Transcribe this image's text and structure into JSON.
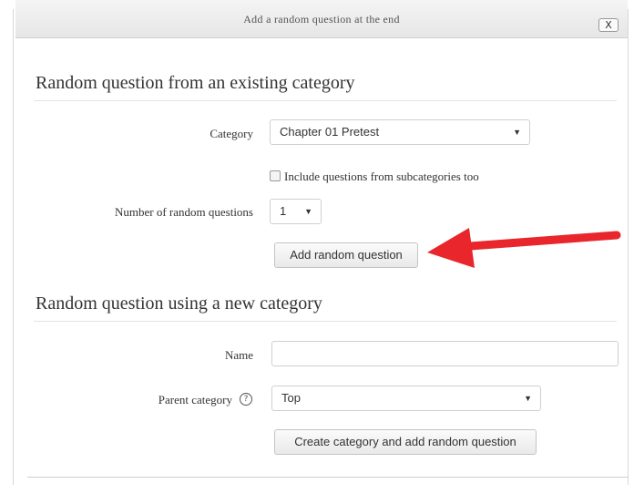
{
  "dialog": {
    "title": "Add a random question at the end",
    "close_label": "X"
  },
  "existing_category": {
    "heading": "Random question from an existing category",
    "category_label": "Category",
    "category_value": "Chapter 01 Pretest",
    "include_subcategories_label": "Include questions from subcategories too",
    "include_subcategories_checked": false,
    "number_label": "Number of random questions",
    "number_value": "1",
    "add_button": "Add random question"
  },
  "new_category": {
    "heading": "Random question using a new category",
    "name_label": "Name",
    "name_value": "",
    "parent_label": "Parent category",
    "parent_value": "Top",
    "create_button": "Create category and add random question"
  },
  "icons": {
    "dropdown": "caret-down-icon",
    "help": "help-icon",
    "annotation": "red-arrow-icon"
  },
  "colors": {
    "annotation_arrow": "#e8262b"
  }
}
